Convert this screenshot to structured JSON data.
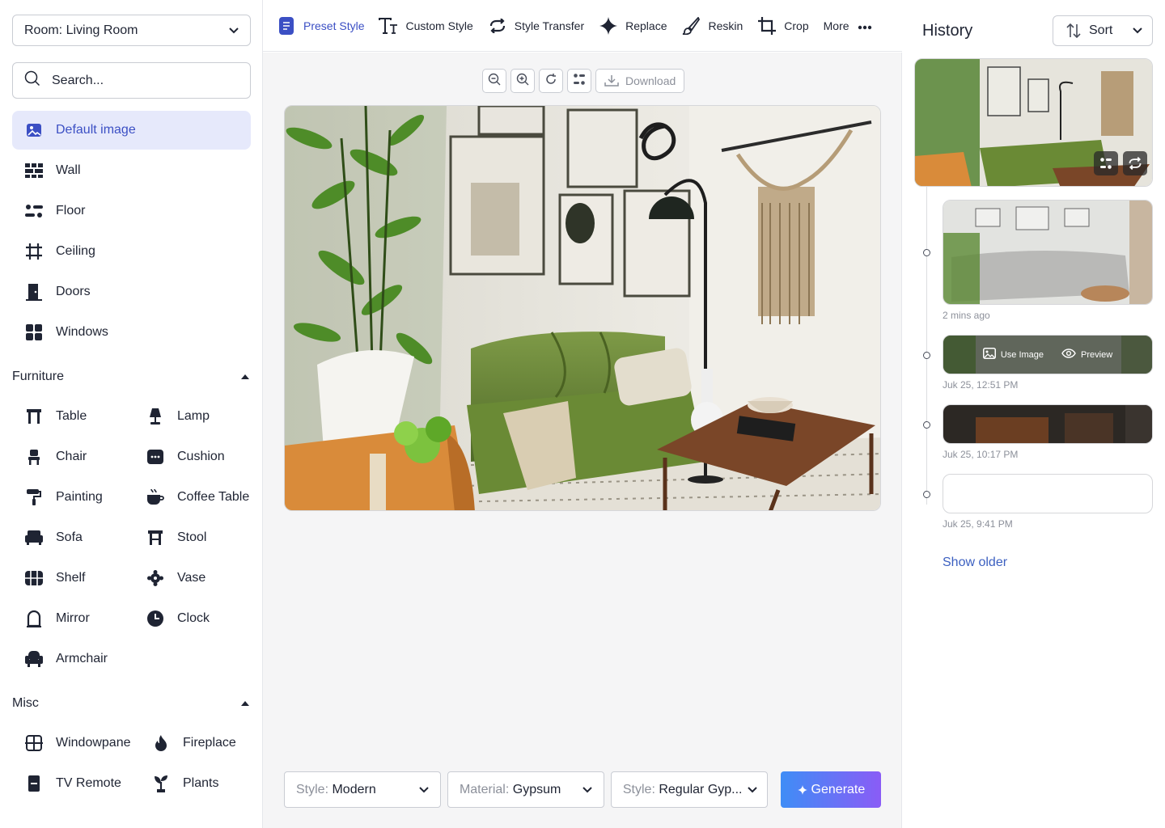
{
  "sidebar": {
    "room_select": "Room: Living Room",
    "search_placeholder": "Search...",
    "items": [
      {
        "label": "Default image",
        "icon": "image-icon"
      },
      {
        "label": "Wall",
        "icon": "brick-wall-icon"
      },
      {
        "label": "Floor",
        "icon": "floor-icon"
      },
      {
        "label": "Ceiling",
        "icon": "frame-icon"
      },
      {
        "label": "Doors",
        "icon": "door-icon"
      },
      {
        "label": "Windows",
        "icon": "window-grid-icon"
      }
    ],
    "furniture": {
      "title": "Furniture",
      "items": [
        {
          "label": "Table",
          "icon": "table-icon"
        },
        {
          "label": "Lamp",
          "icon": "lamp-icon"
        },
        {
          "label": "Chair",
          "icon": "chair-icon"
        },
        {
          "label": "Cushion",
          "icon": "cushion-icon"
        },
        {
          "label": "Painting",
          "icon": "paint-roller-icon"
        },
        {
          "label": "Coffee Table",
          "icon": "coffee-icon"
        },
        {
          "label": "Sofa",
          "icon": "sofa-icon"
        },
        {
          "label": "Stool",
          "icon": "stool-icon"
        },
        {
          "label": "Shelf",
          "icon": "shelf-icon"
        },
        {
          "label": "Vase",
          "icon": "vase-icon"
        },
        {
          "label": "Mirror",
          "icon": "mirror-icon"
        },
        {
          "label": "Clock",
          "icon": "clock-icon"
        },
        {
          "label": "Armchair",
          "icon": "armchair-icon"
        }
      ]
    },
    "misc": {
      "title": "Misc",
      "items": [
        {
          "label": "Windowpane",
          "icon": "windowpane-icon"
        },
        {
          "label": "Fireplace",
          "icon": "fire-icon"
        },
        {
          "label": "TV Remote",
          "icon": "remote-icon"
        },
        {
          "label": "Plants",
          "icon": "plant-icon"
        }
      ]
    }
  },
  "toolbar": {
    "tools": [
      {
        "label": "Preset Style",
        "icon": "document-icon"
      },
      {
        "label": "Custom Style",
        "icon": "text-style-icon"
      },
      {
        "label": "Style Transfer",
        "icon": "transfer-icon"
      },
      {
        "label": "Replace",
        "icon": "sparkle-icon"
      },
      {
        "label": "Reskin",
        "icon": "brush-icon"
      },
      {
        "label": "Crop",
        "icon": "crop-icon"
      },
      {
        "label": "More",
        "icon": "more-dots-icon"
      }
    ]
  },
  "canvas": {
    "download_label": "Download"
  },
  "controls": {
    "style_key": "Style:",
    "style_value": "Modern",
    "material_key": "Material:",
    "material_value": "Gypsum",
    "style2_key": "Style:",
    "style2_value": "Regular Gyp...",
    "generate_label": "Generate"
  },
  "history": {
    "title": "History",
    "sort_label": "Sort",
    "entries": [
      {
        "time": "2 mins ago"
      },
      {
        "time": "Juk 25, 12:51 PM",
        "use_image": "Use Image",
        "preview": "Preview"
      },
      {
        "time": "Juk 25, 10:17 PM"
      },
      {
        "time": "Juk 25, 9:41 PM"
      }
    ],
    "show_older": "Show older"
  },
  "colors": {
    "accent": "#3b4fc4",
    "active_bg": "#e6e9fb",
    "generate_start": "#3f8df6",
    "generate_end": "#8a5cf6"
  }
}
